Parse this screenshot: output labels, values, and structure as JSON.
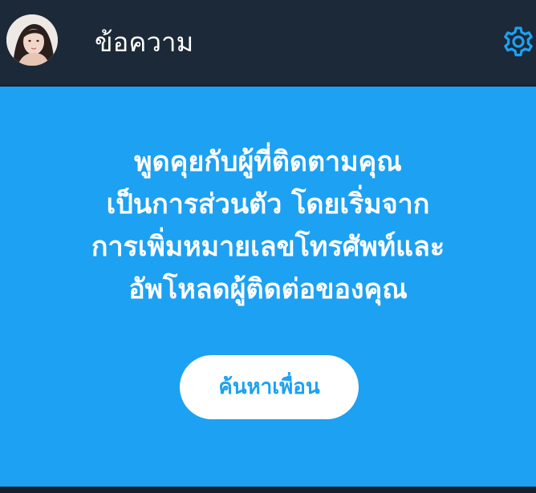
{
  "colors": {
    "background": "#15202b",
    "header": "#1c2938",
    "accent": "#1da1f2",
    "text_on_dark": "#ffffff"
  },
  "header": {
    "title": "ข้อความ",
    "avatar_icon": "user-avatar",
    "settings_icon": "gear-icon"
  },
  "empty_state": {
    "message_lines": [
      "พูดคุยกับผู้ที่ติดตามคุณ",
      "เป็นการส่วนตัว โดยเริ่มจาก",
      "การเพิ่มหมายเลขโทรศัพท์และ",
      "อัพโหลดผู้ติดต่อของคุณ"
    ],
    "button_label": "ค้นหาเพื่อน"
  }
}
